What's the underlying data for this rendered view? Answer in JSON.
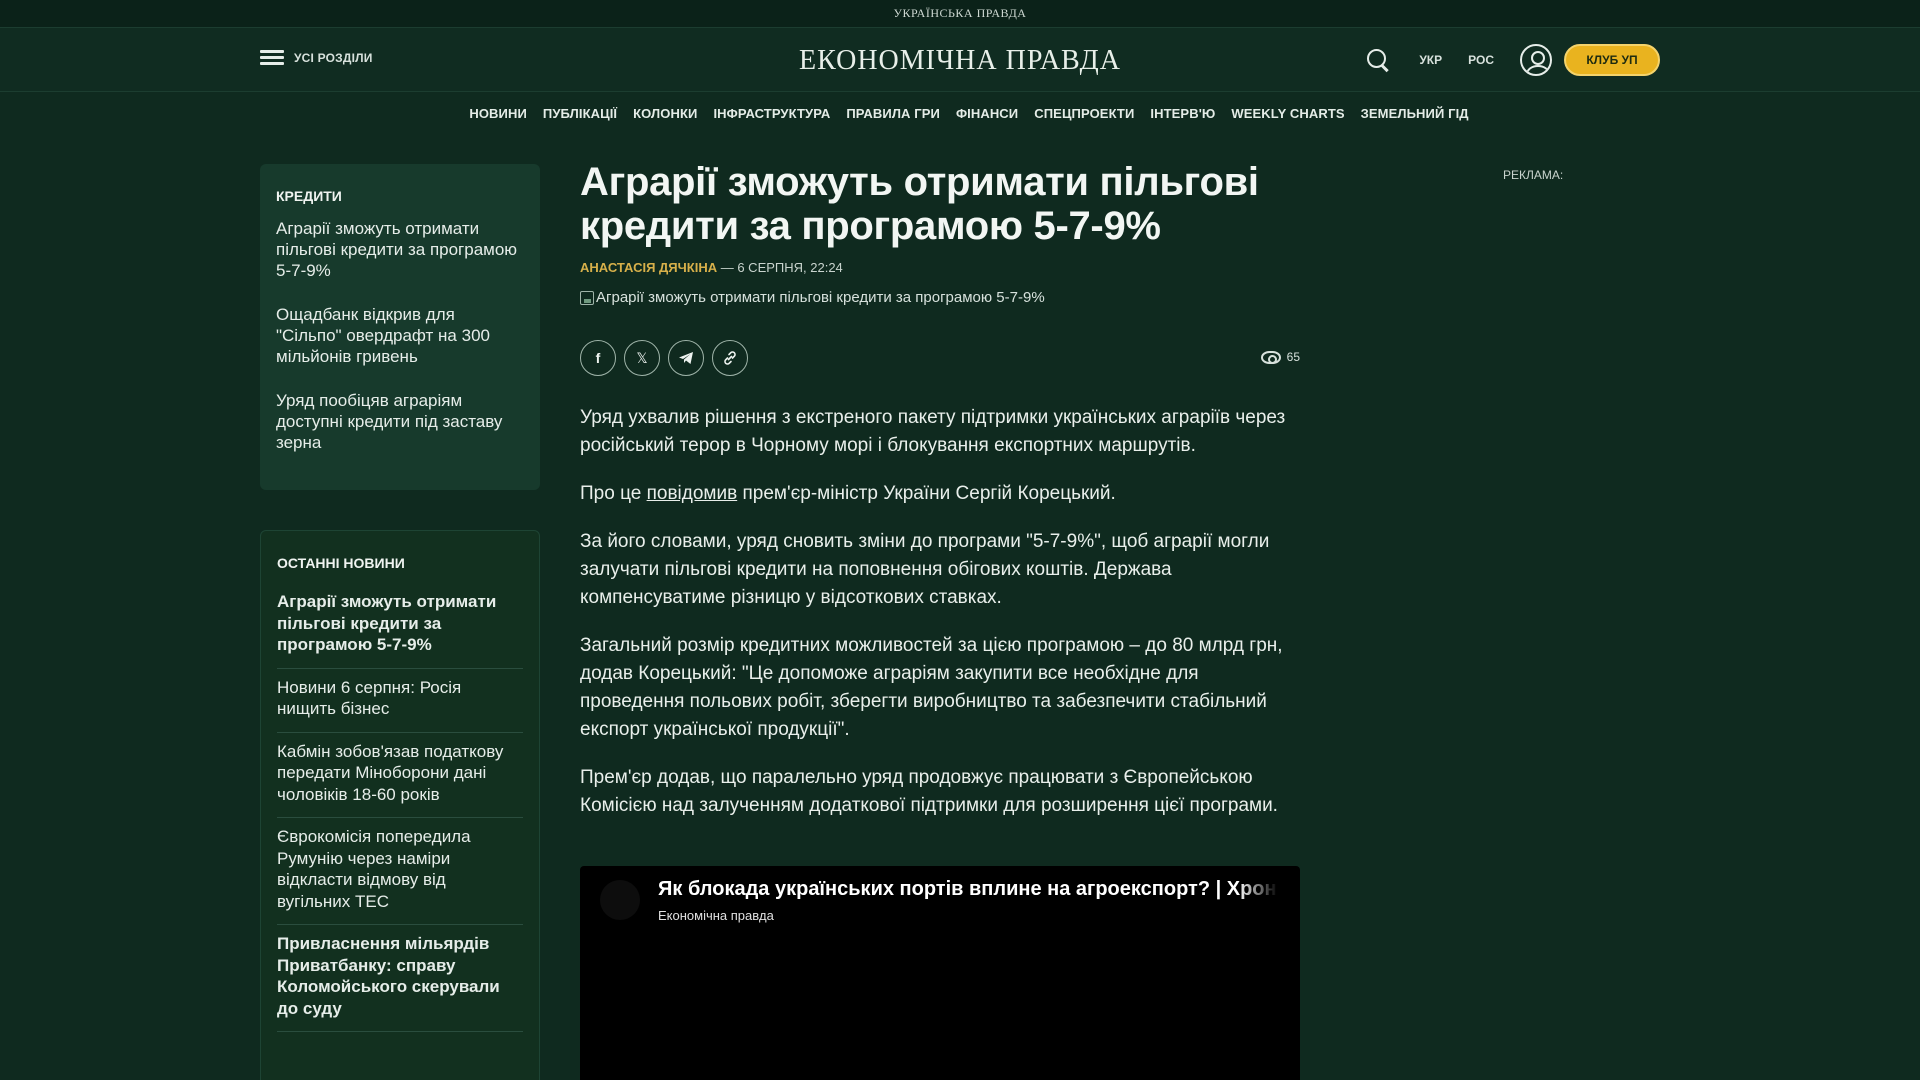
{
  "topstrip": {
    "label": "УКРАЇНСЬКА ПРАВДА"
  },
  "header": {
    "menu_label": "УСІ РОЗДІЛИ",
    "logo": "ЕКОНОМІЧНА ПРАВДА",
    "lang_ukr": "УКР",
    "lang_ros": "РОС",
    "club_button": "КЛУБ УП"
  },
  "nav": {
    "items": [
      "НОВИНИ",
      "ПУБЛІКАЦІЇ",
      "КОЛОНКИ",
      "ІНФРАСТРУКТУРА",
      "ПРАВИЛА ГРИ",
      "ФІНАНСИ",
      "СПЕЦПРОЕКТИ",
      "ІНТЕРВ'Ю",
      "WEEKLY CHARTS",
      "ЗЕМЕЛЬНИЙ ГІД"
    ]
  },
  "credits_box": {
    "title": "КРЕДИТИ",
    "items": [
      "Аграрії зможуть отримати пільгові кредити за програмою 5-7-9%",
      "Ощадбанк відкрив для \"Сільпо\" овердрафт на 300 мільйонів гривень",
      "Уряд пообіцяв аграріям доступні кредити під заставу зерна"
    ]
  },
  "latest_box": {
    "title": "ОСТАННІ НОВИНИ",
    "items": [
      "Аграрії зможуть отримати пільгові кредити за програмою 5-7-9%",
      "Новини 6 серпня: Росія нищить бізнес",
      "Кабмін зобов'язав податкову передати Міноборони дані чоловіків 18-60 років",
      "Єврокомісія попередила Румунію через наміри відкласти відмову від вугільних ТЕС",
      "Привласнення мільярдів Приватбанку: справу Коломойського скерували до суду"
    ]
  },
  "article": {
    "headline": "Аграрії зможуть отримати пільгові кредити за програмою 5-7-9%",
    "author": "АНАСТАСІЯ ДЯЧКІНА",
    "date": " — 6 СЕРПНЯ, 22:24",
    "image_alt": "Аграрії зможуть отримати пільгові кредити за програмою 5-7-9%",
    "views": "65",
    "paragraphs": {
      "p1": "Уряд ухвалив рішення з екстреного пакету підтримки українських аграріїв через російський терор в Чорному морі і блокування експортних маршрутів.",
      "p2_before": "Про це ",
      "p2_link": "повідомив",
      "p2_after": " прем'єр-міністр України Сергій Корецький.",
      "p3": "За його словами, уряд сновить зміни до програми \"5-7-9%\", щоб аграрії могли залучати пільгові кредити на поповнення обігових коштів. Держава компенсуватиме різницю у відсоткових ставках.",
      "p4": "Загальний розмір кредитних можливостей за цією програмою – до 80 млрд грн, додав Корецький: \"Це допоможе аграріям закупити все необхідне для проведення польових робіт, зберегти виробництво та забезпечити стабільний експорт української продукції\".",
      "p5": "Прем'єр додав, що паралельно уряд продовжує працювати з Європейською Комісією над залученням додаткової підтримки для розширення цієї програми."
    }
  },
  "video": {
    "title": "Як блокада українських портів вплине на агроекспорт? | Хроніки",
    "channel": "Економічна правда"
  },
  "ad_label": "РЕКЛАМА:"
}
